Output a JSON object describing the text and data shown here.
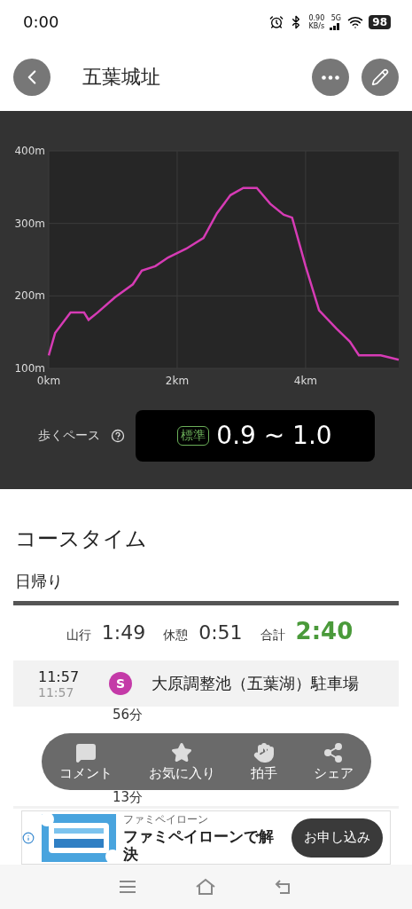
{
  "status_bar": {
    "time": "0:00",
    "net_speed": "0.90",
    "net_unit": "KB/s",
    "network": "5G",
    "battery": "98"
  },
  "header": {
    "title": "五葉城址"
  },
  "elevation": {
    "chart_data": {
      "type": "line",
      "x": [
        0,
        0.1,
        0.34,
        0.55,
        0.62,
        0.76,
        1.03,
        1.31,
        1.45,
        1.66,
        1.86,
        2.14,
        2.41,
        2.62,
        2.83,
        3.03,
        3.24,
        3.45,
        3.66,
        3.79,
        4.0,
        4.21,
        4.48,
        4.69,
        4.83,
        5.17,
        5.45
      ],
      "series": [
        {
          "color": "#d63bb5",
          "values": [
            118,
            149,
            177,
            177,
            167,
            177,
            198,
            216,
            235,
            241,
            253,
            265,
            280,
            314,
            339,
            349,
            349,
            327,
            312,
            308,
            241,
            180,
            155,
            137,
            118,
            118,
            112
          ]
        }
      ],
      "grid": true,
      "xlim": [
        0,
        5.45
      ],
      "ylim": [
        100,
        400
      ],
      "xticks": [
        {
          "value": 0,
          "label": "0km"
        },
        {
          "value": 2,
          "label": "2km"
        },
        {
          "value": 4,
          "label": "4km"
        }
      ],
      "yticks": [
        {
          "value": 100,
          "label": "100m"
        },
        {
          "value": 200,
          "label": "200m"
        },
        {
          "value": 300,
          "label": "300m"
        },
        {
          "value": 400,
          "label": "400m"
        }
      ]
    }
  },
  "pace": {
    "label": "歩くペース",
    "badge": "標準",
    "value": "0.9 ~ 1.0"
  },
  "course_time": {
    "title": "コースタイム",
    "tab": "日帰り",
    "summary": [
      {
        "label": "山行",
        "value": "1:49",
        "kind": "plain"
      },
      {
        "label": "休憩",
        "value": "0:51",
        "kind": "plain"
      },
      {
        "label": "合計",
        "value": "2:40",
        "kind": "total"
      }
    ],
    "stops": [
      {
        "arrive": "11:57",
        "depart": "11:57",
        "marker": "S",
        "name": "大原調整池（五葉湖）駐車場",
        "duration_after": "56分"
      },
      {
        "duration_after": "13分"
      }
    ]
  },
  "action_bar": [
    {
      "kind": "comment",
      "label": "コメント"
    },
    {
      "kind": "favorite",
      "label": "お気に入り"
    },
    {
      "kind": "clap",
      "label": "拍手"
    },
    {
      "kind": "share",
      "label": "シェア"
    }
  ],
  "ad": {
    "brand": "ファミペイローン",
    "headline": "ファミペイローンで解決",
    "button": "お申し込み"
  }
}
